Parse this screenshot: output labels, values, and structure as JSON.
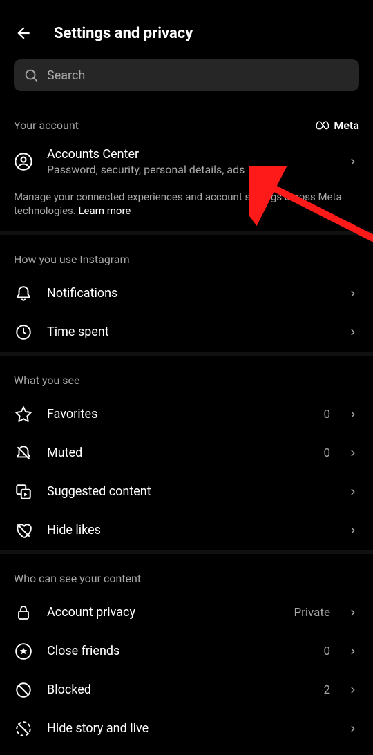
{
  "header": {
    "title": "Settings and privacy"
  },
  "search": {
    "placeholder": "Search"
  },
  "account": {
    "section_label": "Your account",
    "brand": "Meta",
    "accounts_center": {
      "title": "Accounts Center",
      "sub": "Password, security, personal details, ads"
    },
    "description_prefix": "Manage your connected experiences and account settings across Meta technologies. ",
    "learn_more": "Learn more"
  },
  "how_use": {
    "section_label": "How you use Instagram",
    "notifications": "Notifications",
    "time_spent": "Time spent"
  },
  "what_see": {
    "section_label": "What you see",
    "favorites": "Favorites",
    "favorites_count": "0",
    "muted": "Muted",
    "muted_count": "0",
    "suggested": "Suggested content",
    "hide_likes": "Hide likes"
  },
  "who_see": {
    "section_label": "Who can see your content",
    "account_privacy": "Account privacy",
    "account_privacy_value": "Private",
    "close_friends": "Close friends",
    "close_friends_count": "0",
    "blocked": "Blocked",
    "blocked_count": "2",
    "hide_story": "Hide story and live"
  }
}
